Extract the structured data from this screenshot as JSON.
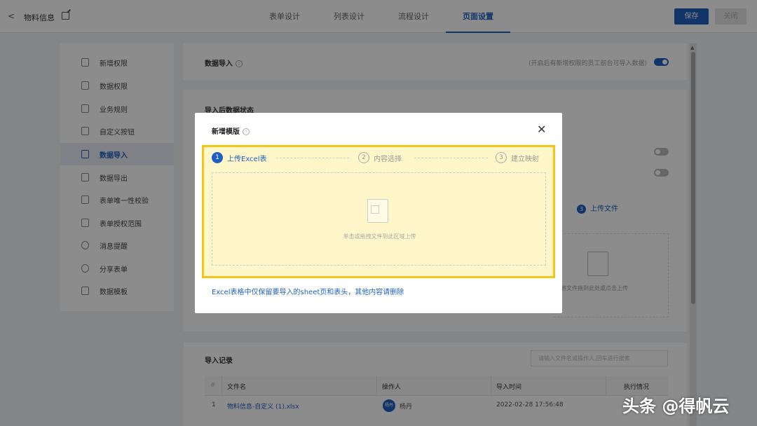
{
  "header": {
    "back_icon": "chevron-left-icon",
    "title": "物料信息",
    "edit_icon": "edit-icon",
    "tabs": [
      {
        "label": "表单设计"
      },
      {
        "label": "列表设计"
      },
      {
        "label": "流程设计"
      },
      {
        "label": "页面设置"
      }
    ],
    "save_label": "保存",
    "close_label": "关闭"
  },
  "sidebar": {
    "items": [
      {
        "label": "新增权限",
        "icon": "doc-lock-icon"
      },
      {
        "label": "数据权限",
        "icon": "shield-icon"
      },
      {
        "label": "业务规则",
        "icon": "sliders-icon"
      },
      {
        "label": "自定义按钮",
        "icon": "button-icon"
      },
      {
        "label": "数据导入",
        "icon": "import-icon"
      },
      {
        "label": "数据导出",
        "icon": "export-icon"
      },
      {
        "label": "表单唯一性校验",
        "icon": "check-circle-icon"
      },
      {
        "label": "表单授权范围",
        "icon": "doc-key-icon"
      },
      {
        "label": "消息提醒",
        "icon": "clock-icon"
      },
      {
        "label": "分享表单",
        "icon": "share-icon"
      },
      {
        "label": "数据模板",
        "icon": "template-icon"
      }
    ]
  },
  "import_section": {
    "title": "数据导入",
    "hint": "(开启后有新增权限的员工前台可导入数据)",
    "enabled": true
  },
  "status_section": {
    "title": "导入后数据状态"
  },
  "background_step": {
    "num": "3",
    "label": "上传文件",
    "drop_text": "将文件拖到此处或点击上传"
  },
  "records": {
    "title": "导入记录",
    "search_placeholder": "请输入文件名或操作人,回车进行搜索",
    "columns": [
      "#",
      "文件名",
      "操作人",
      "导入时间",
      "执行情况"
    ],
    "rows": [
      {
        "index": "1",
        "file": "物料信息-自定义 (1).xlsx",
        "avatar": "杨丹",
        "operator": "杨丹",
        "time": "2022-02-28 17:56:48",
        "status": ""
      }
    ]
  },
  "modal": {
    "title": "新增模版",
    "close_icon": "close-icon",
    "steps": [
      {
        "num": "1",
        "label": "上传Excel表"
      },
      {
        "num": "2",
        "label": "内容选择"
      },
      {
        "num": "3",
        "label": "建立映射"
      }
    ],
    "drop_text": "单击或拖拽文件到此区域上传",
    "note": "Excel表格中仅保留要导入的sheet页和表头，其他内容请删除"
  },
  "watermark": "头条 @得帆云",
  "colors": {
    "primary": "#1f5fbf",
    "highlight_border": "#f5c518",
    "highlight_fill": "#fff7c9"
  }
}
